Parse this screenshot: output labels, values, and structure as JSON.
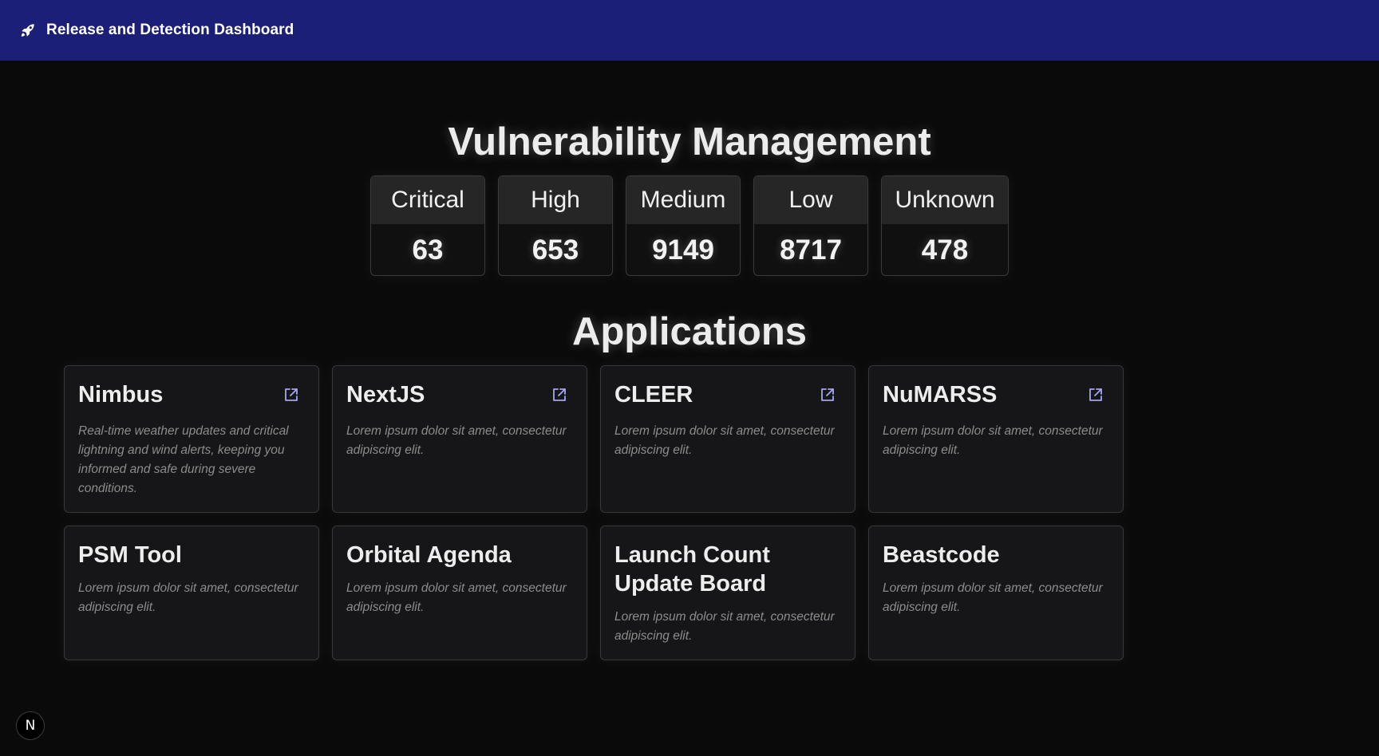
{
  "header": {
    "title": "Release and Detection Dashboard",
    "logo_icon": "rocket-icon",
    "background": "#1c1f78"
  },
  "vulnerability": {
    "title": "Vulnerability Management",
    "stats": [
      {
        "label": "Critical",
        "value": "63"
      },
      {
        "label": "High",
        "value": "653"
      },
      {
        "label": "Medium",
        "value": "9149"
      },
      {
        "label": "Low",
        "value": "8717"
      },
      {
        "label": "Unknown",
        "value": "478"
      }
    ]
  },
  "applications": {
    "title": "Applications",
    "items": [
      {
        "name": "Nimbus",
        "description": "Real-time weather updates and critical lightning and wind alerts, keeping you informed and safe during severe conditions.",
        "has_link": true
      },
      {
        "name": "NextJS",
        "description": "Lorem ipsum dolor sit amet, consectetur adipiscing elit.",
        "has_link": true
      },
      {
        "name": "CLEER",
        "description": "Lorem ipsum dolor sit amet, consectetur adipiscing elit.",
        "has_link": true
      },
      {
        "name": "NuMARSS",
        "description": "Lorem ipsum dolor sit amet, consectetur adipiscing elit.",
        "has_link": true
      },
      {
        "name": "PSM Tool",
        "description": "Lorem ipsum dolor sit amet, consectetur adipiscing elit.",
        "has_link": false
      },
      {
        "name": "Orbital Agenda",
        "description": "Lorem ipsum dolor sit amet, consectetur adipiscing elit.",
        "has_link": false
      },
      {
        "name": "Launch Count Update Board",
        "description": "Lorem ipsum dolor sit amet, consectetur adipiscing elit.",
        "has_link": false
      },
      {
        "name": "Beastcode",
        "description": "Lorem ipsum dolor sit amet, consectetur adipiscing elit.",
        "has_link": false
      }
    ]
  },
  "dev_badge": {
    "label": "N",
    "icon": "nextjs-devtools-icon"
  },
  "colors": {
    "accent_icon": "#a9a4f5",
    "page_background": "#0a0a0a"
  }
}
